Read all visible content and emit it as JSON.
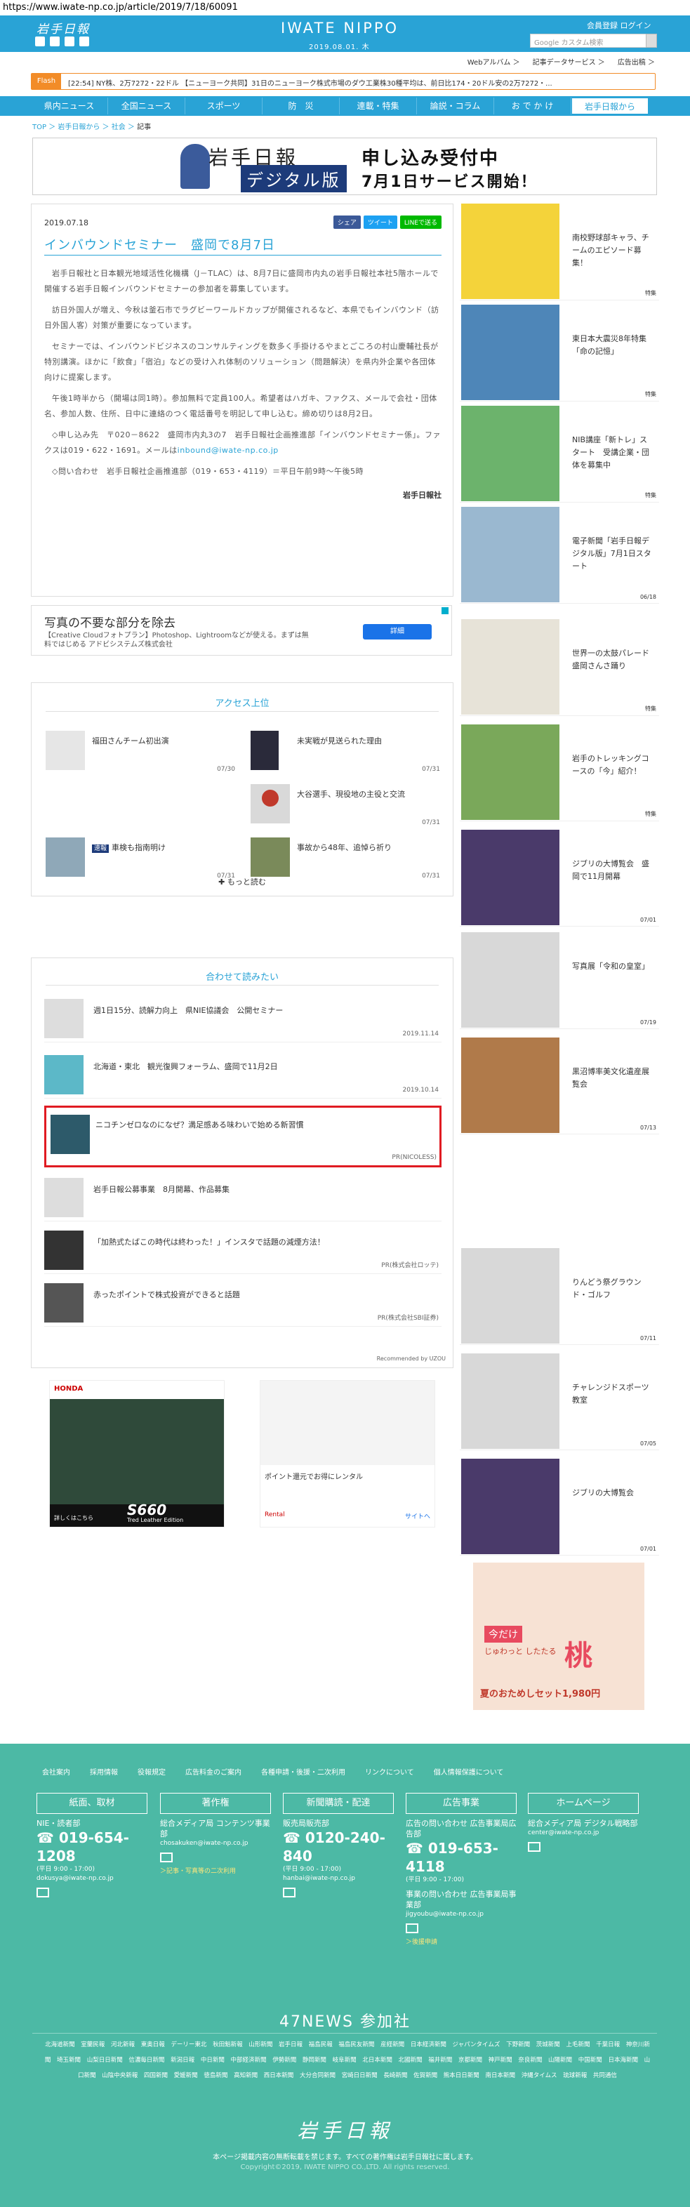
{
  "browser": {
    "url": "https://www.iwate-np.co.jp/article/2019/7/18/60091"
  },
  "header": {
    "logo_text": "岩手日報",
    "brand": "IWATE NIPPO",
    "date": "2019.08.01. 木",
    "member_links": "会員登録 ログイン",
    "search_placeholder": "Google カスタム検索"
  },
  "subnav": {
    "items": [
      "Webアルバム ＞",
      "記事データサービス ＞",
      "広告出稿 ＞"
    ]
  },
  "flash": {
    "label": "Flash",
    "text": "[22:54] NY株、2万7272・22ドル  【ニューヨーク共同】31日のニューヨーク株式市場のダウ工業株30種平均は、前日比174・20ドル安の2万7272・..."
  },
  "global_nav": {
    "items": [
      "県内ニュース",
      "全国ニュース",
      "スポーツ",
      "防　災",
      "連載・特集",
      "論説・コラム",
      "お で か け",
      "岩手日報から"
    ],
    "active_index": 7
  },
  "breadcrumb": {
    "items": [
      "TOP",
      "岩手日報から",
      "社会"
    ],
    "current": "記事"
  },
  "banner": {
    "left1": "岩手日報",
    "left2": "デジタル版",
    "right1": "申し込み受付中",
    "right2": "7月1日サービス開始！"
  },
  "article": {
    "date": "2019.07.18",
    "share": [
      "シェア",
      "ツイート",
      "LINEで送る"
    ],
    "title": "インバウンドセミナー　盛岡で8月7日",
    "paragraphs": [
      "岩手日報社と日本観光地域活性化機構（J－TLAC）は、8月7日に盛岡市内丸の岩手日報社本社5階ホールで開催する岩手日報インバウンドセミナーの参加者を募集しています。",
      "訪日外国人が増え、今秋は釜石市でラグビーワールドカップが開催されるなど、本県でもインバウンド（訪日外国人客）対策が重要になっています。",
      "セミナーでは、インバウンドビジネスのコンサルティングを数多く手掛けるやまとごころの村山慶輔社長が特別講演。ほかに「飲食」「宿泊」などの受け入れ体制のソリューション（問題解決）を県内外企業や各団体向けに提案します。",
      "午後1時半から（開場は同1時）。参加無料で定員100人。希望者はハガキ、ファクス、メールで会社・団体名、参加人数、住所、日中に連絡のつく電話番号を明記して申し込む。締め切りは8月2日。",
      "◇申し込み先　〒020－8622　盛岡市内丸3の7　岩手日報社企画推進部「インバウンドセミナー係」。ファクスは019・622・1691。メールは",
      "◇問い合わせ　岩手日報社企画推進部（019・653・4119）＝平日午前9時～午後5時"
    ],
    "email": "inbound@iwate-np.co.jp",
    "signature": "岩手日報社"
  },
  "ad_adobe": {
    "title": "写真の不要な部分を除去",
    "desc": "【Creative Cloudフォトプラン】Photoshop、Lightroomなどが使える。まずは無料ではじめる アドビシステムズ株式会社",
    "button": "詳細"
  },
  "ranking": {
    "title": "アクセス上位",
    "items": [
      {
        "title": "福田さんチーム初出演",
        "date": "07/30",
        "tag": ""
      },
      {
        "title": "未実戦が見送られた理由",
        "date": "07/31",
        "tag": ""
      },
      {
        "title": "大谷選手、現役地の主役と交流",
        "date": "07/31",
        "tag": ""
      },
      {
        "title": "車検も指南明け",
        "date": "07/31",
        "tag": "速報"
      },
      {
        "title": "事故から48年、追悼ら祈り",
        "date": "07/31",
        "tag": ""
      }
    ],
    "more": "もっと読む"
  },
  "related": {
    "title": "合わせて読みたい",
    "items": [
      {
        "title": "週1日15分、読解力向上　県NIE協議会　公開セミナー",
        "date": "2019.11.14"
      },
      {
        "title": "北海道・東北　観光復興フォーラム、盛岡で11月2日",
        "date": "2019.10.14"
      },
      {
        "title": "ニコチンゼロなのになぜ？満足感ある味わいで始める新習慣",
        "date": "PR(NICOLESS)"
      },
      {
        "title": "岩手日報公募事業　8月開幕、作品募集",
        "date": ""
      },
      {
        "title": "「加熱式たばこの時代は終わった！」インスタで話題の減煙方法！",
        "date": "PR(株式会社ロッテ)"
      },
      {
        "title": "赤ったポイントで株式投資ができると話題",
        "date": "PR(株式会社SBI証券)"
      }
    ],
    "recommended": "Recommended by UZOU"
  },
  "ads_bottom": {
    "honda_brand": "HONDA",
    "honda_model": "S660",
    "honda_edition": "Tred Leather Edition",
    "honda_more": "詳しくはこちら",
    "rental_title": "ポイント還元でお得にレンタル",
    "rental_brand": "Rental",
    "rental_site": "サイトへ"
  },
  "sidebar": {
    "items": [
      {
        "title": "南校野球部キャラ、チームのエピソード募集！",
        "date": "特集"
      },
      {
        "title": "東日本大震災8年特集「命の記憶」",
        "date": "特集"
      },
      {
        "title": "NIB講座「新トレ」スタート　受講企業・団体を募集中",
        "date": "特集"
      },
      {
        "title": "電子新聞「岩手日報デジタル版」7月1日スタート",
        "date": "06/18"
      },
      {
        "title": "世界一の太鼓パレード　盛岡さんさ踊り",
        "date": "特集"
      },
      {
        "title": "岩手のトレッキングコースの「今」紹介！",
        "date": "特集"
      },
      {
        "title": "ジブリの大博覧会　盛岡で11月開幕",
        "date": "07/01"
      },
      {
        "title": "写真展「令和の皇室」",
        "date": "07/19"
      },
      {
        "title": "黒沼博率美文化遺産展覧会",
        "date": "07/13"
      },
      {
        "title": "りんどう祭グラウンド・ゴルフ",
        "date": "07/11"
      },
      {
        "title": "チャレンジドスポーツ教室",
        "date": "07/05"
      },
      {
        "title": "ジブリの大博覧会",
        "date": "07/01"
      }
    ],
    "ad_text1": "今だけ",
    "ad_text2": "じゅわっと したたる",
    "ad_text3": "桃",
    "ad_text4": "夏のおためしセット1,980円"
  },
  "footer": {
    "nav": [
      "会社案内",
      "採用情報",
      "役報規定",
      "広告料金のご案内",
      "各種申請・後援・二次利用",
      "リンクについて",
      "個人情報保護について"
    ],
    "cols": [
      {
        "head": "紙面、取材",
        "line": "NIE・読者部",
        "tel": "019-654-1208",
        "hours": "(平日 9:00 - 17:00)",
        "mail": "dokusya@iwate-np.co.jp",
        "link": ""
      },
      {
        "head": "著作権",
        "line": "総合メディア局 コンテンツ事業部",
        "tel": "",
        "hours": "",
        "mail": "chosakuken@iwate-np.co.jp",
        "link": "＞記事・写真等の二次利用"
      },
      {
        "head": "新聞購読・配達",
        "line": "販売局販売部",
        "tel": "0120-240-840",
        "hours": "(平日 9:00 - 17:00)",
        "mail": "hanbai@iwate-np.co.jp",
        "link": ""
      },
      {
        "head": "広告事業",
        "line": "広告の問い合わせ 広告事業局広告部",
        "tel": "019-653-4118",
        "hours": "(平日 9:00 - 17:00)",
        "mail": "jigyoubu@iwate-np.co.jp",
        "link": "＞後援申請",
        "line2": "事業の問い合わせ 広告事業局事業部"
      },
      {
        "head": "ホームページ",
        "line": "総合メディア局 デジタル戦略部",
        "tel": "",
        "hours": "",
        "mail": "center@iwate-np.co.jp",
        "link": ""
      }
    ],
    "news47_title": "47NEWS 参加社",
    "news47_list": "北海道新聞 室蘭民報 河北新報 東奥日報 デーリー東北 秋田魁新報 山形新聞 岩手日報 福島民報 福島民友新聞 産経新聞 日本経済新聞 ジャパンタイムズ 下野新聞 茨城新聞 上毛新聞 千葉日報 神奈川新聞 埼玉新聞 山梨日日新聞 信濃毎日新聞 新潟日報 中日新聞 中部経済新聞 伊勢新聞 静岡新聞 岐阜新聞 北日本新聞 北國新聞 福井新聞 京都新聞 神戸新聞 奈良新聞 山陽新聞 中国新聞 日本海新聞 山口新聞 山陰中央新報 四国新聞 愛媛新聞 徳島新聞 高知新聞 西日本新聞 大分合同新聞 宮崎日日新聞 長崎新聞 佐賀新聞 熊本日日新聞 南日本新聞 沖縄タイムス 琉球新報 共同通信",
    "logo": "岩手日報",
    "note": "本ページ掲載内容の無断転載を禁じます。すべての著作権は岩手日報社に属します。",
    "copyright": "Copyright©2019, IWATE NIPPO CO.,LTD. All rights reserved."
  }
}
